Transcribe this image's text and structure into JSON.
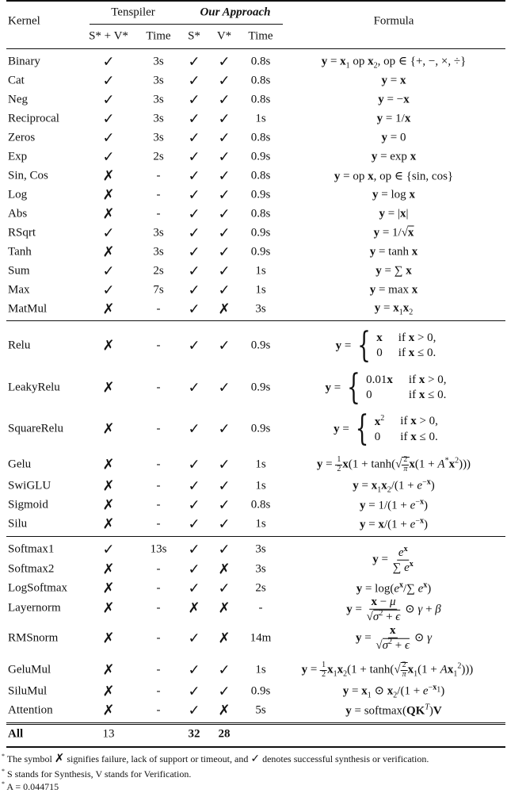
{
  "header": {
    "kernel": "Kernel",
    "tenspiler": "Tenspiler",
    "our_approach": "Our Approach",
    "formula": "Formula",
    "sv": "S* + V*",
    "time1": "Time",
    "s": "S*",
    "v": "V*",
    "time2": "Time"
  },
  "marks": {
    "check": "✓",
    "cross": "✗",
    "dash": "-"
  },
  "groups": [
    {
      "rows": [
        {
          "kernel": "Binary",
          "sv": "check",
          "t_time": "3s",
          "s": "check",
          "v": "check",
          "time": "0.8s",
          "formula": "y = x₁ op x₂, op ∈ {+, −, ×, ÷}"
        },
        {
          "kernel": "Cat",
          "sv": "check",
          "t_time": "3s",
          "s": "check",
          "v": "check",
          "time": "0.8s",
          "formula": "y = x"
        },
        {
          "kernel": "Neg",
          "sv": "check",
          "t_time": "3s",
          "s": "check",
          "v": "check",
          "time": "0.8s",
          "formula": "y = −x"
        },
        {
          "kernel": "Reciprocal",
          "sv": "check",
          "t_time": "3s",
          "s": "check",
          "v": "check",
          "time": "1s",
          "formula": "y = 1/x"
        },
        {
          "kernel": "Zeros",
          "sv": "check",
          "t_time": "3s",
          "s": "check",
          "v": "check",
          "time": "0.8s",
          "formula": "y = 0"
        },
        {
          "kernel": "Exp",
          "sv": "check",
          "t_time": "2s",
          "s": "check",
          "v": "check",
          "time": "0.9s",
          "formula": "y = exp x"
        },
        {
          "kernel": "Sin, Cos",
          "sv": "cross",
          "t_time": "-",
          "s": "check",
          "v": "check",
          "time": "0.8s",
          "formula": "y = op x, op ∈ {sin, cos}"
        },
        {
          "kernel": "Log",
          "sv": "cross",
          "t_time": "-",
          "s": "check",
          "v": "check",
          "time": "0.9s",
          "formula": "y = log x"
        },
        {
          "kernel": "Abs",
          "sv": "cross",
          "t_time": "-",
          "s": "check",
          "v": "check",
          "time": "0.8s",
          "formula": "y = |x|"
        },
        {
          "kernel": "RSqrt",
          "sv": "check",
          "t_time": "3s",
          "s": "check",
          "v": "check",
          "time": "0.9s",
          "formula": "y = 1/√x"
        },
        {
          "kernel": "Tanh",
          "sv": "cross",
          "t_time": "3s",
          "s": "check",
          "v": "check",
          "time": "0.9s",
          "formula": "y = tanh x"
        },
        {
          "kernel": "Sum",
          "sv": "check",
          "t_time": "2s",
          "s": "check",
          "v": "check",
          "time": "1s",
          "formula": "y = ∑ x"
        },
        {
          "kernel": "Max",
          "sv": "check",
          "t_time": "7s",
          "s": "check",
          "v": "check",
          "time": "1s",
          "formula": "y = max x"
        },
        {
          "kernel": "MatMul",
          "sv": "cross",
          "t_time": "-",
          "s": "check",
          "v": "cross",
          "time": "3s",
          "formula": "y = x₁x₂"
        }
      ]
    },
    {
      "rows": [
        {
          "kernel": "Relu",
          "sv": "cross",
          "t_time": "-",
          "s": "check",
          "v": "check",
          "time": "0.9s",
          "formula": {
            "lhs": "y =",
            "cases": [
              [
                "x",
                "if x > 0,"
              ],
              [
                "0",
                "if x ≤ 0."
              ]
            ]
          }
        },
        {
          "kernel": "LeakyRelu",
          "sv": "cross",
          "t_time": "-",
          "s": "check",
          "v": "check",
          "time": "0.9s",
          "formula": {
            "lhs": "y =",
            "cases": [
              [
                "0.01x",
                "if x > 0,"
              ],
              [
                "0",
                "if x ≤ 0."
              ]
            ]
          }
        },
        {
          "kernel": "SquareRelu",
          "sv": "cross",
          "t_time": "-",
          "s": "check",
          "v": "check",
          "time": "0.9s",
          "formula": {
            "lhs": "y =",
            "cases": [
              [
                "x²",
                "if x > 0,"
              ],
              [
                "0",
                "if x ≤ 0."
              ]
            ]
          }
        },
        {
          "kernel": "Gelu",
          "sv": "cross",
          "t_time": "-",
          "s": "check",
          "v": "check",
          "time": "1s",
          "formula": "y = ½x(1 + tanh(√(2/π) x(1 + A*x²)))"
        },
        {
          "kernel": "SwiGLU",
          "sv": "cross",
          "t_time": "-",
          "s": "check",
          "v": "check",
          "time": "1s",
          "formula": "y = x₁x₂/(1 + e^−x)"
        },
        {
          "kernel": "Sigmoid",
          "sv": "cross",
          "t_time": "-",
          "s": "check",
          "v": "check",
          "time": "0.8s",
          "formula": "y = 1/(1 + e^−x)"
        },
        {
          "kernel": "Silu",
          "sv": "cross",
          "t_time": "-",
          "s": "check",
          "v": "check",
          "time": "1s",
          "formula": "y = x/(1 + e^−x)"
        }
      ]
    },
    {
      "rows": [
        {
          "kernel": "Softmax1",
          "sv": "check",
          "t_time": "13s",
          "s": "check",
          "v": "check",
          "time": "3s",
          "formula": "y = e^x / ∑ e^x"
        },
        {
          "kernel": "Softmax2",
          "sv": "cross",
          "t_time": "-",
          "s": "check",
          "v": "cross",
          "time": "3s",
          "formula": ""
        },
        {
          "kernel": "LogSoftmax",
          "sv": "cross",
          "t_time": "-",
          "s": "check",
          "v": "check",
          "time": "2s",
          "formula": "y = log(e^x/∑ e^x)"
        },
        {
          "kernel": "Layernorm",
          "sv": "cross",
          "t_time": "-",
          "s": "cross",
          "v": "cross",
          "time": "-",
          "formula": "y = (x − μ)/√(σ² + ϵ) ⊙ γ + β"
        },
        {
          "kernel": "RMSnorm",
          "sv": "cross",
          "t_time": "-",
          "s": "check",
          "v": "cross",
          "time": "14m",
          "formula": "y = x/√(σ² + ϵ) ⊙ γ"
        },
        {
          "kernel": "GeluMul",
          "sv": "cross",
          "t_time": "-",
          "s": "check",
          "v": "check",
          "time": "1s",
          "formula": "y = ½x₁x₂(1 + tanh(√(2/π) x₁(1 + Ax₁²)))"
        },
        {
          "kernel": "SiluMul",
          "sv": "cross",
          "t_time": "-",
          "s": "check",
          "v": "check",
          "time": "0.9s",
          "formula": "y = x₁ ⊙ x₂/(1 + e^−x₁)"
        },
        {
          "kernel": "Attention",
          "sv": "cross",
          "t_time": "-",
          "s": "check",
          "v": "cross",
          "time": "5s",
          "formula": "y = softmax(QKᵀ)V"
        }
      ]
    }
  ],
  "totals": {
    "label": "All",
    "tenspiler": "13",
    "s": "32",
    "v": "28"
  },
  "footnotes": [
    {
      "marker": "*",
      "pre": "The symbol",
      "mid": "signifies failure, lack of support or timeout, and",
      "post": "denotes successful synthesis or verification."
    },
    {
      "marker": "*",
      "text": "S stands for Synthesis, V stands for Verification."
    },
    {
      "marker": "*",
      "text": "A = 0.044715"
    }
  ]
}
